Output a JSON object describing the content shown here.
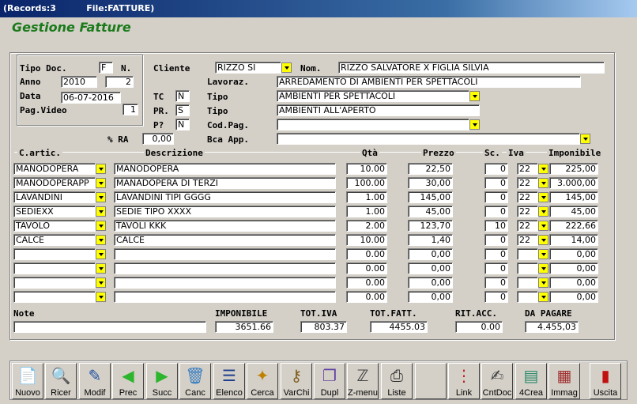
{
  "window": {
    "title": "(Records:3          File:FATTURE)"
  },
  "app_title": "Gestione Fatture",
  "header": {
    "tipo_doc_label": "Tipo Doc.",
    "tipo_doc_value": "F",
    "n_label": "N.",
    "n_value": "",
    "anno_label": "Anno",
    "anno_value": "2010",
    "anno_num": "2",
    "data_label": "Data",
    "data_value": "06-07-2016",
    "pag_video_label": "Pag.Video",
    "pag_video_value": "1",
    "cliente_label": "Cliente",
    "cliente_value": "RIZZO SI",
    "nom_label": "Nom.",
    "nom_value": "RIZZO SALVATORE X FIGLIA SILVIA",
    "lavoraz_label": "Lavoraz.",
    "lavoraz_value": "ARREDAMENTO DI AMBIENTI PER SPETTACOLI",
    "tc_label": "TC",
    "tc_value": "N",
    "tipo1_label": "Tipo",
    "tipo1_value": "AMBIENTI PER SPETTACOLI",
    "pr_label": "PR.",
    "pr_value": "S",
    "tipo2_label": "Tipo",
    "tipo2_value": "AMBIENTI ALL'APERTO",
    "pq_label": "P?",
    "pq_value": "N",
    "codpag_label": "Cod.Pag.",
    "codpag_value": "",
    "ra_label": "% RA",
    "ra_value": "0,00",
    "bca_label": "Bca App.",
    "bca_value": ""
  },
  "columns": {
    "c_artic": "C.artic.",
    "descrizione": "Descrizione",
    "qta": "Qtà",
    "prezzo": "Prezzo",
    "sc": "Sc.",
    "iva": "Iva",
    "imponibile": "Imponibile"
  },
  "rows": [
    {
      "code": "MANODOPERA",
      "desc": "MANODOPERA",
      "qta": "10.00",
      "prezzo": "22,50",
      "sc": "0",
      "iva": "22",
      "imp": "225,00"
    },
    {
      "code": "MANODOPERAPP",
      "desc": "MANADOPERA DI TERZI",
      "qta": "100.00",
      "prezzo": "30,00",
      "sc": "0",
      "iva": "22",
      "imp": "3.000,00"
    },
    {
      "code": "LAVANDINI",
      "desc": "LAVANDINI TIPI GGGG",
      "qta": "1.00",
      "prezzo": "145,00",
      "sc": "0",
      "iva": "22",
      "imp": "145,00"
    },
    {
      "code": "SEDIEXX",
      "desc": "SEDIE TIPO XXXX",
      "qta": "1.00",
      "prezzo": "45,00",
      "sc": "0",
      "iva": "22",
      "imp": "45,00"
    },
    {
      "code": "TAVOLO",
      "desc": "TAVOLI KKK",
      "qta": "2.00",
      "prezzo": "123,70",
      "sc": "10",
      "iva": "22",
      "imp": "222,66"
    },
    {
      "code": "CALCE",
      "desc": "CALCE",
      "qta": "10.00",
      "prezzo": "1,40",
      "sc": "0",
      "iva": "22",
      "imp": "14,00"
    },
    {
      "code": "",
      "desc": "",
      "qta": "0.00",
      "prezzo": "0,00",
      "sc": "0",
      "iva": "",
      "imp": "0,00"
    },
    {
      "code": "",
      "desc": "",
      "qta": "0.00",
      "prezzo": "0,00",
      "sc": "0",
      "iva": "",
      "imp": "0,00"
    },
    {
      "code": "",
      "desc": "",
      "qta": "0.00",
      "prezzo": "0,00",
      "sc": "0",
      "iva": "",
      "imp": "0,00"
    },
    {
      "code": "",
      "desc": "",
      "qta": "0.00",
      "prezzo": "0,00",
      "sc": "0",
      "iva": "",
      "imp": "0,00"
    }
  ],
  "footer": {
    "note_label": "Note",
    "note_value": "",
    "imponibile_label": "IMPONIBILE",
    "imponibile_value": "3651.66",
    "totiva_label": "TOT.IVA",
    "totiva_value": "803.37",
    "totfatt_label": "TOT.FATT.",
    "totfatt_value": "4455.03",
    "ritacc_label": "RIT.ACC.",
    "ritacc_value": "0.00",
    "dapagare_label": "DA PAGARE",
    "dapagare_value": "4.455,03"
  },
  "toolbar": [
    {
      "name": "nuovo",
      "label": "Nuovo",
      "icon": "new-document-icon",
      "glyph": "📄",
      "color": "#2a8a2a"
    },
    {
      "name": "ricer",
      "label": "Ricer",
      "icon": "search-icon",
      "glyph": "🔍",
      "color": "#333"
    },
    {
      "name": "modif",
      "label": "Modif",
      "icon": "edit-icon",
      "glyph": "✎",
      "color": "#1f4fa0"
    },
    {
      "name": "prec",
      "label": "Prec",
      "icon": "arrow-left-icon",
      "glyph": "◀",
      "color": "#2db52d"
    },
    {
      "name": "succ",
      "label": "Succ",
      "icon": "arrow-right-icon",
      "glyph": "▶",
      "color": "#2db52d"
    },
    {
      "name": "canc",
      "label": "Canc",
      "icon": "trash-icon",
      "glyph": "🗑",
      "color": "#3a7ec0"
    },
    {
      "name": "elenco",
      "label": "Elenco",
      "icon": "list-icon",
      "glyph": "☰",
      "color": "#1f3f8f"
    },
    {
      "name": "cerca",
      "label": "Cerca",
      "icon": "find-icon",
      "glyph": "✦",
      "color": "#c08000"
    },
    {
      "name": "varchi",
      "label": "VarChi",
      "icon": "keys-icon",
      "glyph": "⚷",
      "color": "#806020"
    },
    {
      "name": "dupl",
      "label": "Dupl",
      "icon": "duplicate-icon",
      "glyph": "❐",
      "color": "#6040a0"
    },
    {
      "name": "zmenu",
      "label": "Z-menu",
      "icon": "zmenu-icon",
      "glyph": "ℤ",
      "color": "#404040"
    },
    {
      "name": "liste",
      "label": "Liste",
      "icon": "printer-icon",
      "glyph": "⎙",
      "color": "#303030"
    },
    {
      "name": "link",
      "label": "Link",
      "icon": "link-icon",
      "glyph": "⋮",
      "color": "#c02020"
    },
    {
      "name": "cntdoc",
      "label": "CntDoc",
      "icon": "count-document-icon",
      "glyph": "✍",
      "color": "#404040"
    },
    {
      "name": "4crea",
      "label": "4Crea",
      "icon": "create-icon",
      "glyph": "▤",
      "color": "#2a8a6a"
    },
    {
      "name": "immag",
      "label": "Immag",
      "icon": "image-card-icon",
      "glyph": "▦",
      "color": "#a03030"
    },
    {
      "name": "uscita",
      "label": "Uscita",
      "icon": "exit-door-icon",
      "glyph": "▮",
      "color": "#c01010"
    }
  ]
}
